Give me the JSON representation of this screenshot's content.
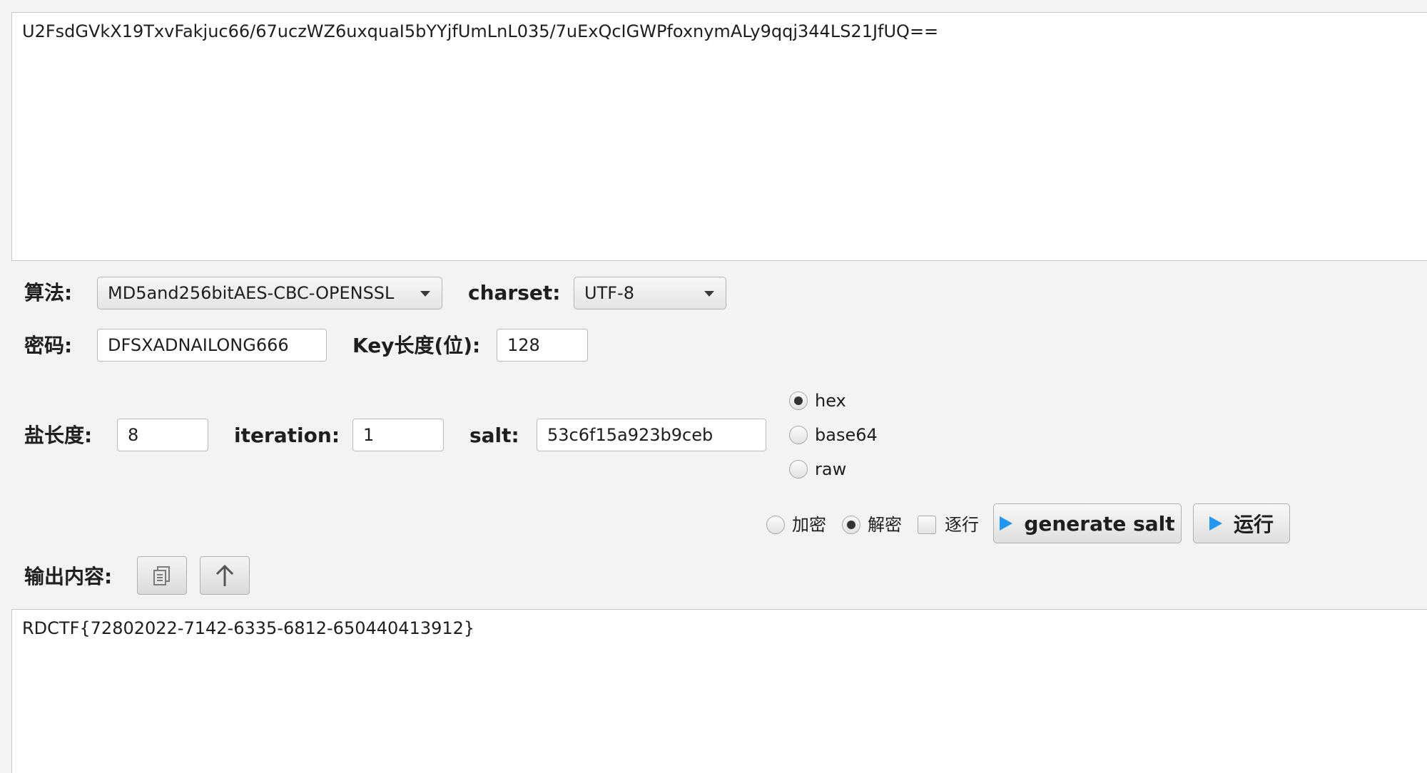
{
  "input": {
    "text": "U2FsdGVkX19TxvFakjuc66/67uczWZ6uxquaI5bYYjfUmLnL035/7uExQcIGWPfoxnymALy9qqj344LS21JfUQ=="
  },
  "algorithm": {
    "label": "算法:",
    "selected": "MD5and256bitAES-CBC-OPENSSL"
  },
  "charset": {
    "label": "charset:",
    "selected": "UTF-8"
  },
  "password": {
    "label": "密码:",
    "value": "DFSXADNAILONG666"
  },
  "key_length": {
    "label": "Key长度(位):",
    "value": "128"
  },
  "salt_length": {
    "label": "盐长度:",
    "value": "8"
  },
  "iteration": {
    "label": "iteration:",
    "value": "1"
  },
  "salt": {
    "label": "salt:",
    "value": "53c6f15a923b9ceb"
  },
  "salt_format": {
    "options": [
      {
        "label": "hex",
        "selected": true
      },
      {
        "label": "base64",
        "selected": false
      },
      {
        "label": "raw",
        "selected": false
      }
    ]
  },
  "mode": {
    "encrypt_label": "加密",
    "encrypt_selected": false,
    "decrypt_label": "解密",
    "decrypt_selected": true,
    "line_by_line_label": "逐行",
    "line_by_line_checked": false
  },
  "buttons": {
    "generate_salt": "generate salt",
    "run": "运行"
  },
  "output": {
    "label": "输出内容:",
    "text": "RDCTF{72802022-7142-6335-6812-650440413912}"
  },
  "icons": {
    "copy": "copy-icon",
    "upload": "arrow-up-icon",
    "play": "play-icon",
    "accent_color": "#2196f3"
  }
}
